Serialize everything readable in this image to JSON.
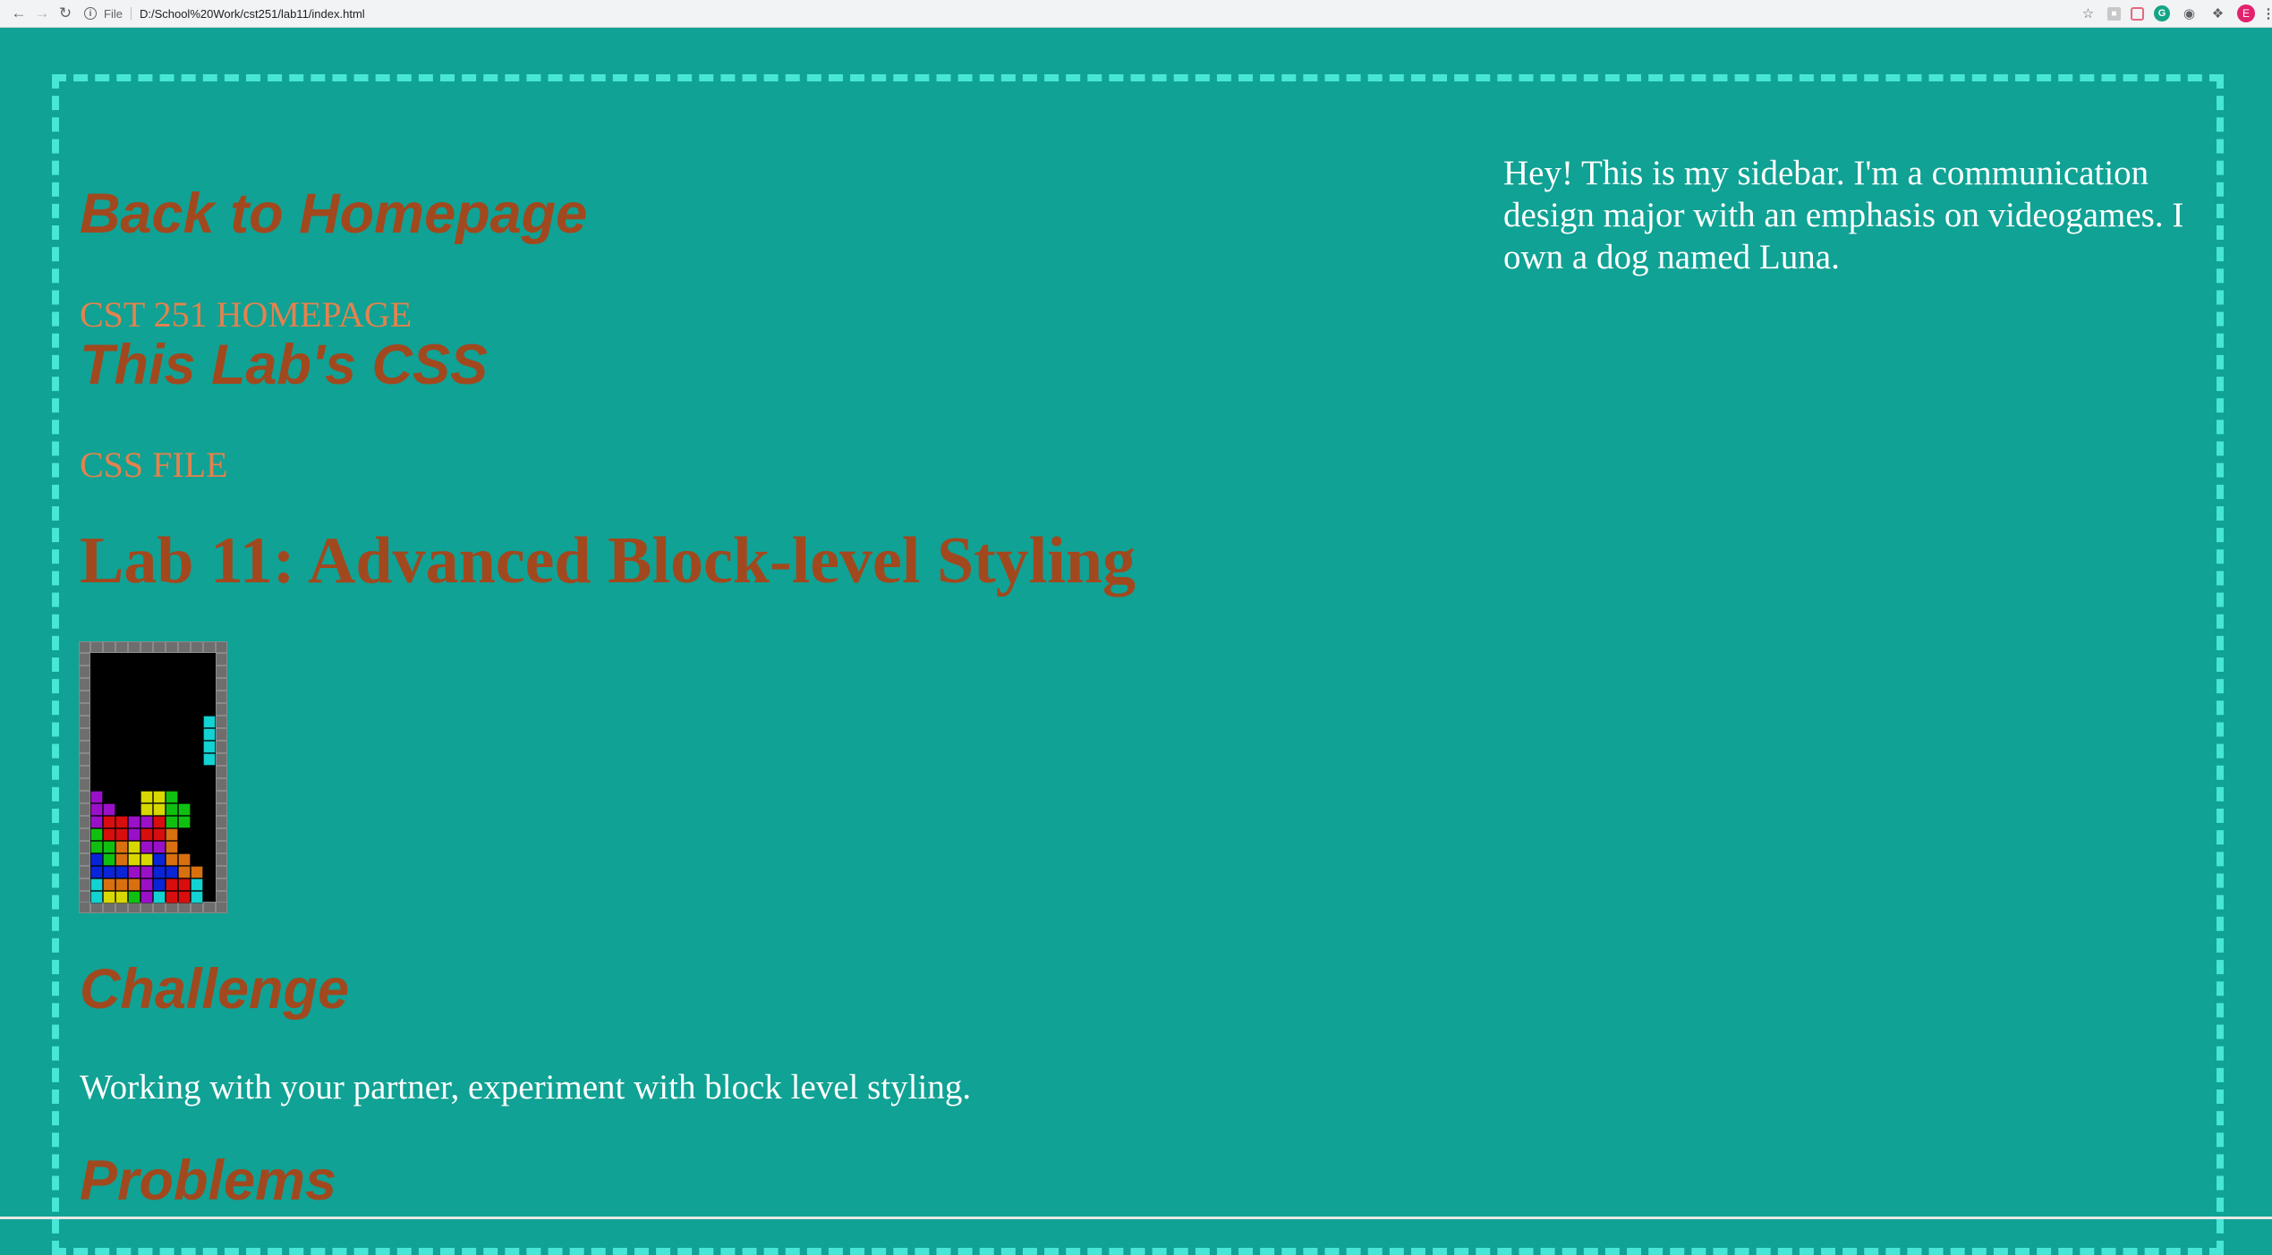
{
  "browser": {
    "scheme_label": "File",
    "url": "D:/School%20Work/cst251/lab11/index.html"
  },
  "page": {
    "back_link": "Back to Homepage",
    "homepage_link": "CST 251 HOMEPAGE",
    "css_heading": "This Lab's CSS",
    "css_link": "CSS FILE",
    "title": "Lab 11: Advanced Block-level Styling",
    "challenge_heading": "Challenge",
    "challenge_text": "Working with your partner, experiment with block level styling.",
    "problems_heading": "Problems",
    "sidebar_text": "Hey! This is my sidebar. I'm a communication design major with an emphasis on videogames. I own a dog named Luna."
  },
  "tetris_image": {
    "description_icon": "tetris-game-screenshot",
    "colors": {
      "border": "#6e6e6e",
      "well": "#000000",
      "I": "#12d2d2",
      "O": "#d8d800",
      "T": "#9a10c8",
      "S": "#10c010",
      "Z": "#d80e0e",
      "J": "#0a24d8",
      "L": "#d87010"
    },
    "rows": [
      "..........",
      "..........",
      "..........",
      "..........",
      "..........",
      ".........I",
      ".........I",
      ".........I",
      ".........I",
      "..........",
      "..........",
      "T...OOS...",
      "TT..OOSS..",
      "TZZTTZSS..",
      "SZZTZZL...",
      "SSLOTTL...",
      "JSLOOJLL..",
      "JJJTTJJLL.",
      "ILLLTJZZI.",
      "IOOSTIZZI."
    ]
  },
  "colors": {
    "page_bg": "#10a294",
    "frame_border": "#47e6d6",
    "heading": "#a2481e",
    "link": "#e3824e",
    "text": "#ffffff"
  }
}
